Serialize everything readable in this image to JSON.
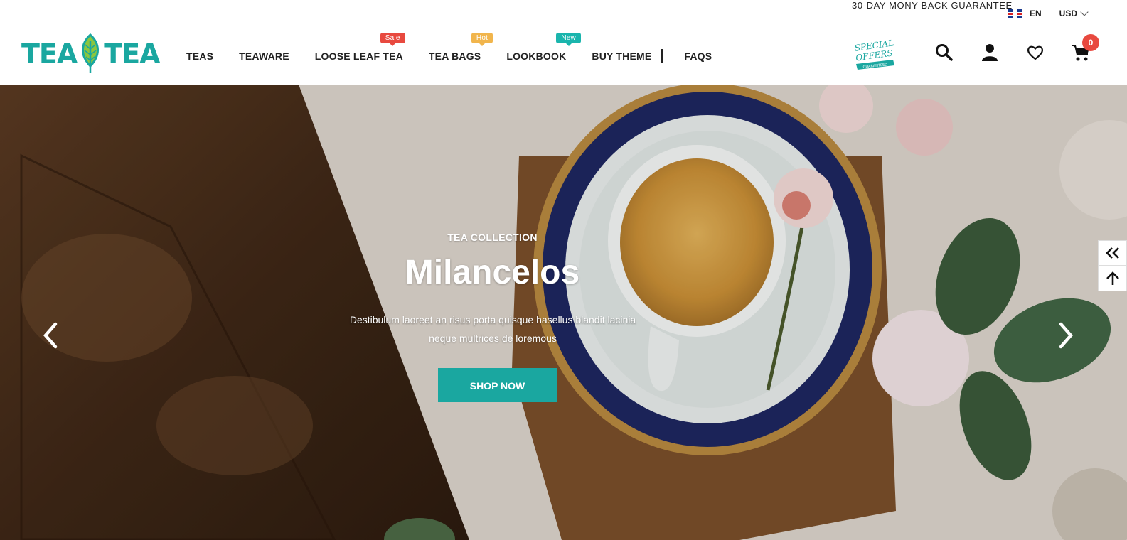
{
  "topbar": {
    "guarantee": "30-DAY MONY BACK GUARANTEE",
    "language": "EN",
    "currency": "USD"
  },
  "header": {
    "logo_left": "TEA",
    "logo_right": "TEA",
    "nav": [
      {
        "label": "TEAS"
      },
      {
        "label": "TEAWARE"
      },
      {
        "label": "LOOSE LEAF TEA",
        "badge": "Sale"
      },
      {
        "label": "TEA BAGS",
        "badge": "Hot"
      },
      {
        "label": "LOOKBOOK",
        "badge": "New"
      },
      {
        "label": "BUY THEME"
      },
      {
        "label": "FAQS"
      }
    ],
    "offers_line1": "SPECIAL",
    "offers_line2": "OFFERS",
    "offers_ribbon": "GUARANTEED",
    "cart_count": "0"
  },
  "hero": {
    "subtitle": "TEA COLLECTION",
    "title": "Milancelos",
    "description": "Destibulum laoreet an risus porta quisque hasellus blandit lacinia neque multrices de loremous",
    "button": "SHOP NOW"
  },
  "colors": {
    "accent": "#1aa7a0",
    "sale": "#e8493f",
    "hot": "#f1b54c",
    "new": "#1ab5ad"
  }
}
